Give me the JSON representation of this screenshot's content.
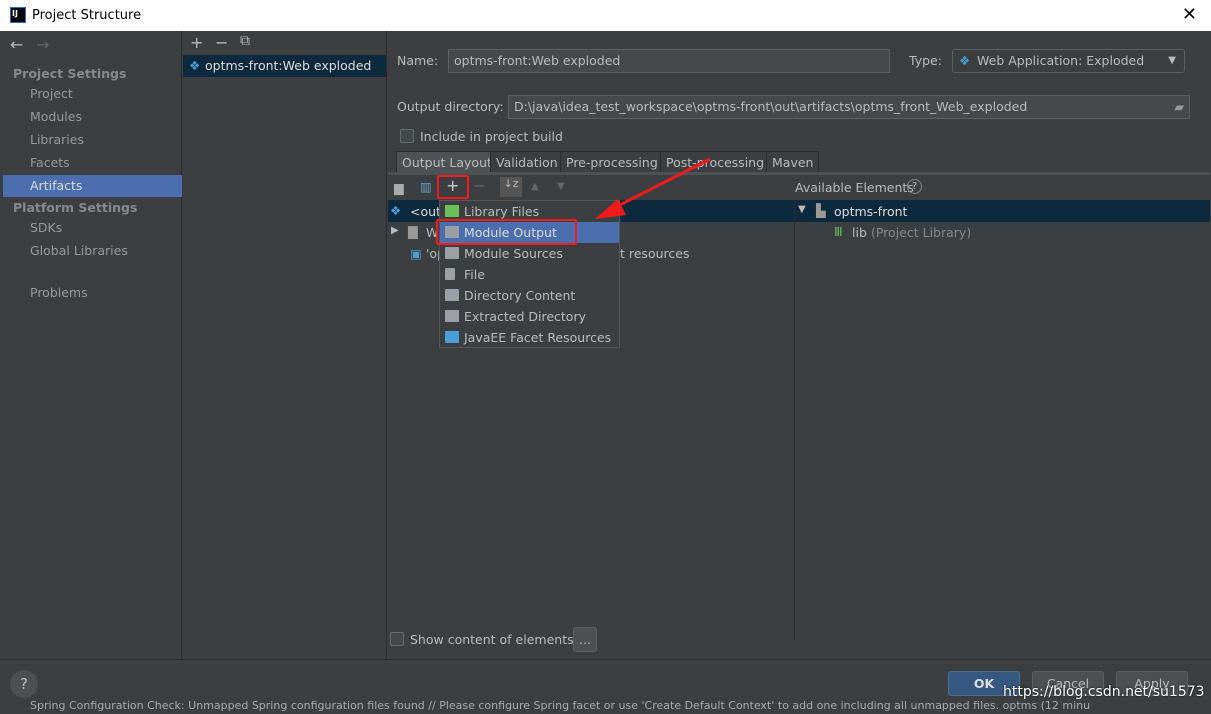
{
  "window": {
    "title": "Project Structure",
    "logo": "IJ",
    "close": "✕"
  },
  "sidebar": {
    "back": "←",
    "forward": "→",
    "project_settings": "Project Settings",
    "project_items": [
      "Project",
      "Modules",
      "Libraries",
      "Facets",
      "Artifacts"
    ],
    "selected": "Artifacts",
    "platform_settings": "Platform Settings",
    "platform_items": [
      "SDKs",
      "Global Libraries"
    ],
    "problems": "Problems"
  },
  "artifact_list": {
    "add": "+",
    "remove": "−",
    "copy": "⧉",
    "items": [
      "optms-front:Web exploded"
    ]
  },
  "form": {
    "name_label": "Name:",
    "name_value": "optms-front:Web exploded",
    "type_label": "Type:",
    "type_value": "Web Application: Exploded",
    "output_label": "Output directory:",
    "output_value": "D:\\java\\idea_test_workspace\\optms-front\\out\\artifacts\\optms_front_Web_exploded",
    "include_label": "Include in project build",
    "include_checked": false
  },
  "tabs": [
    "Output Layout",
    "Validation",
    "Pre-processing",
    "Post-processing",
    "Maven"
  ],
  "active_tab": "Output Layout",
  "layout_tree": {
    "root": "<output root>",
    "row2": "W",
    "row3": "'op",
    "row3_tail": "t resources"
  },
  "available": {
    "title": "Available Elements",
    "help": "?",
    "module": "optms-front",
    "lib": "lib",
    "lib_note": "(Project Library)"
  },
  "add_menu": {
    "items": [
      "Library Files",
      "Module Output",
      "Module Sources",
      "File",
      "Directory Content",
      "Extracted Directory",
      "JavaEE Facet Resources"
    ],
    "selected": "Module Output"
  },
  "bottom": {
    "show_content": "Show content of elements",
    "ellipsis": "...",
    "help": "?",
    "ok": "OK",
    "cancel": "Cancel",
    "apply": "Apply"
  },
  "watermark": "https://blog.csdn.net/su1573",
  "status_text": "Spring Configuration Check: Unmapped Spring configuration files found // Please configure Spring facet or use 'Create Default Context' to add one including all unmapped files. optms (12 minu",
  "colors": {
    "accent": "#4b6eaf",
    "selection_dark": "#0d293e",
    "annotation": "#f21a1a"
  }
}
